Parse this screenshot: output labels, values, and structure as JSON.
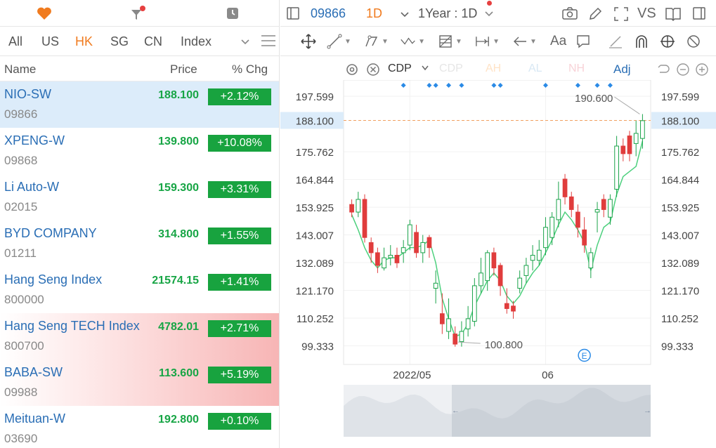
{
  "left_toolbar": {
    "icons": [
      "heart-icon",
      "filter-icon",
      "clock-icon"
    ],
    "favorite_color": "#f07b1f",
    "badge_color": "#e64040"
  },
  "market_tabs": [
    {
      "label": "All",
      "active": false
    },
    {
      "label": "US",
      "active": false
    },
    {
      "label": "HK",
      "active": true
    },
    {
      "label": "SG",
      "active": false
    },
    {
      "label": "CN",
      "active": false
    },
    {
      "label": "Index",
      "active": false
    }
  ],
  "columns": {
    "name": "Name",
    "price": "Price",
    "change": "% Chg"
  },
  "watchlist": [
    {
      "name": "NIO-SW",
      "code": "09866",
      "price": "188.100",
      "change": "+2.12%",
      "state": "selected"
    },
    {
      "name": "XPENG-W",
      "code": "09868",
      "price": "139.800",
      "change": "+10.08%",
      "state": ""
    },
    {
      "name": "Li Auto-W",
      "code": "02015",
      "price": "159.300",
      "change": "+3.31%",
      "state": ""
    },
    {
      "name": "BYD COMPANY",
      "code": "01211",
      "price": "314.800",
      "change": "+1.55%",
      "state": ""
    },
    {
      "name": "Hang Seng Index",
      "code": "800000",
      "price": "21574.15",
      "change": "+1.41%",
      "state": ""
    },
    {
      "name": "Hang Seng TECH Index",
      "code": "800700",
      "price": "4782.01",
      "change": "+2.71%",
      "state": "highlight"
    },
    {
      "name": "BABA-SW",
      "code": "09988",
      "price": "113.600",
      "change": "+5.19%",
      "state": "highlight"
    },
    {
      "name": "Meituan-W",
      "code": "03690",
      "price": "192.800",
      "change": "+0.10%",
      "state": ""
    }
  ],
  "chart_header": {
    "symbol": "09866",
    "interval": "1D",
    "range": "1Year : 1D",
    "compare": "VS",
    "icons": [
      "layout-icon",
      "chevron-down-icon",
      "camera-icon",
      "pencil-icon",
      "fullscreen-icon",
      "book-icon",
      "panel-icon"
    ],
    "accent": "#2a6eb5",
    "interval_color": "#f07b1f"
  },
  "drawing_tools": [
    "move-icon",
    "line-tool-icon",
    "polyline-tool-icon",
    "wave-tool-icon",
    "fib-tool-icon",
    "measure-tool-icon",
    "arrow-tool-icon",
    "text-tool-icon",
    "note-tool-icon",
    "ruler-icon",
    "magnet-icon",
    "lock-icon",
    "hide-icon"
  ],
  "text_tool_label": "Aa",
  "legend": {
    "icons": [
      "settings-icon",
      "close-circle-icon"
    ],
    "indicator": "CDP",
    "items": [
      "CDP",
      "AH",
      "AL",
      "NH"
    ],
    "adj": "Adj",
    "controls": [
      "undo-icon",
      "zoom-out-icon",
      "zoom-in-icon"
    ]
  },
  "chart_data": {
    "type": "candlestick",
    "y_ticks": [
      "197.599",
      "175.762",
      "164.844",
      "153.925",
      "143.007",
      "132.089",
      "121.170",
      "110.252",
      "99.333"
    ],
    "ylim": [
      92,
      204
    ],
    "x_ticks": [
      {
        "label": "2022/05",
        "index": 9
      },
      {
        "label": "06",
        "index": 30
      }
    ],
    "last_price": "188.100",
    "last_value": 188.1,
    "high_annotation": {
      "label": "190.600",
      "index": 45,
      "value": 190.6
    },
    "low_annotation": {
      "label": "100.800",
      "index": 16,
      "value": 100.8
    },
    "event_marker": "E",
    "event_index": 36,
    "marker_indices": [
      8,
      12,
      13,
      15,
      17,
      22,
      23,
      30,
      35,
      38,
      40
    ],
    "colors": {
      "up": "#1aa34a",
      "down": "#e03c3c",
      "line": "#4cd07d",
      "price_line": "#f0a060",
      "marker": "#2a8ae6"
    },
    "candles": [
      [
        155,
        152,
        157,
        150
      ],
      [
        152,
        157,
        160,
        150
      ],
      [
        157,
        142,
        159,
        140
      ],
      [
        140,
        136,
        142,
        132
      ],
      [
        136,
        131,
        138,
        128
      ],
      [
        130,
        134,
        138,
        129
      ],
      [
        134,
        135,
        139,
        131
      ],
      [
        135,
        132,
        138,
        130
      ],
      [
        136,
        138,
        141,
        132
      ],
      [
        139,
        147,
        149,
        137
      ],
      [
        144,
        136,
        147,
        134
      ],
      [
        136,
        140,
        143,
        132
      ],
      [
        142,
        138,
        143,
        134
      ],
      [
        122,
        124,
        129,
        116
      ],
      [
        112,
        108,
        120,
        104
      ],
      [
        105,
        110,
        118,
        102
      ],
      [
        104,
        100,
        107,
        99
      ],
      [
        101,
        105,
        109,
        99
      ],
      [
        106,
        110,
        115,
        103
      ],
      [
        109,
        123,
        126,
        107
      ],
      [
        123,
        128,
        134,
        120
      ],
      [
        125,
        136,
        137,
        121
      ],
      [
        136,
        130,
        138,
        127
      ],
      [
        131,
        123,
        132,
        119
      ],
      [
        116,
        114,
        122,
        112
      ],
      [
        115,
        113,
        117,
        110
      ],
      [
        122,
        126,
        129,
        120
      ],
      [
        127,
        131,
        134,
        124
      ],
      [
        133,
        135,
        139,
        129
      ],
      [
        133,
        137,
        141,
        131
      ],
      [
        138,
        146,
        150,
        135
      ],
      [
        142,
        150,
        152,
        139
      ],
      [
        149,
        157,
        164,
        146
      ],
      [
        165,
        158,
        167,
        155
      ],
      [
        158,
        153,
        160,
        150
      ],
      [
        152,
        146,
        155,
        142
      ],
      [
        145,
        139,
        150,
        136
      ],
      [
        130,
        136,
        138,
        126
      ],
      [
        152,
        153,
        156,
        144
      ],
      [
        157,
        153,
        159,
        150
      ],
      [
        150,
        157,
        159,
        147
      ],
      [
        161,
        178,
        182,
        158
      ],
      [
        178,
        175,
        181,
        172
      ],
      [
        182,
        175,
        184,
        172
      ],
      [
        179,
        183,
        188,
        174
      ],
      [
        181,
        188,
        190.6,
        177
      ]
    ],
    "line": [
      151,
      145,
      138,
      133,
      130,
      133,
      134,
      134,
      136,
      138,
      138,
      139,
      141,
      132,
      118,
      110,
      103,
      104,
      108,
      115,
      120,
      125,
      128,
      125,
      119,
      116,
      119,
      124,
      128,
      131,
      136,
      141,
      147,
      152,
      149,
      145,
      140,
      129,
      139,
      146,
      148,
      159,
      166,
      168,
      170,
      180
    ]
  }
}
